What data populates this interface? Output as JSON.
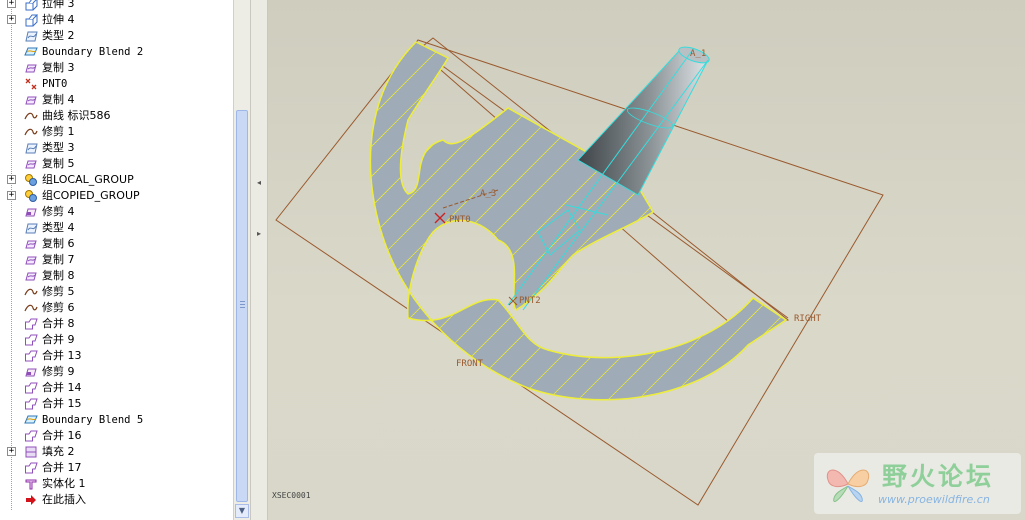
{
  "model_tree": {
    "items": [
      {
        "label": "拉伸 3",
        "icon": "extrude-icon",
        "expandable": true
      },
      {
        "label": "拉伸 4",
        "icon": "extrude-icon",
        "expandable": true
      },
      {
        "label": "类型 2",
        "icon": "style-curve-icon",
        "expandable": false
      },
      {
        "label": "Boundary Blend 2",
        "icon": "boundary-blend-icon",
        "expandable": false
      },
      {
        "label": "复制 3",
        "icon": "copy-surface-icon",
        "expandable": false
      },
      {
        "label": "PNT0",
        "icon": "datum-point-icon",
        "expandable": false
      },
      {
        "label": "复制 4",
        "icon": "copy-surface-icon",
        "expandable": false
      },
      {
        "label": "曲线 标识586",
        "icon": "datum-curve-icon",
        "expandable": false
      },
      {
        "label": "修剪 1",
        "icon": "datum-curve-icon",
        "expandable": false
      },
      {
        "label": "类型 3",
        "icon": "style-curve-icon",
        "expandable": false
      },
      {
        "label": "复制 5",
        "icon": "copy-surface-icon",
        "expandable": false
      },
      {
        "label": "组LOCAL_GROUP",
        "icon": "group-icon",
        "expandable": true
      },
      {
        "label": "组COPIED_GROUP",
        "icon": "group-icon",
        "expandable": true
      },
      {
        "label": "修剪 4",
        "icon": "trim-surface-icon",
        "expandable": false
      },
      {
        "label": "类型 4",
        "icon": "style-curve-icon",
        "expandable": false
      },
      {
        "label": "复制 6",
        "icon": "copy-surface-icon",
        "expandable": false
      },
      {
        "label": "复制 7",
        "icon": "copy-surface-icon",
        "expandable": false
      },
      {
        "label": "复制 8",
        "icon": "copy-surface-icon",
        "expandable": false
      },
      {
        "label": "修剪 5",
        "icon": "datum-curve-icon",
        "expandable": false
      },
      {
        "label": "修剪 6",
        "icon": "datum-curve-icon",
        "expandable": false
      },
      {
        "label": "合并 8",
        "icon": "merge-icon",
        "expandable": false
      },
      {
        "label": "合并 9",
        "icon": "merge-icon",
        "expandable": false
      },
      {
        "label": "合并 13",
        "icon": "merge-icon",
        "expandable": false
      },
      {
        "label": "修剪 9",
        "icon": "trim-surface-icon",
        "expandable": false
      },
      {
        "label": "合并 14",
        "icon": "merge-icon",
        "expandable": false
      },
      {
        "label": "合并 15",
        "icon": "merge-icon",
        "expandable": false
      },
      {
        "label": "Boundary Blend 5",
        "icon": "boundary-blend-icon",
        "expandable": false
      },
      {
        "label": "合并 16",
        "icon": "merge-icon",
        "expandable": false
      },
      {
        "label": "填充 2",
        "icon": "fill-icon",
        "expandable": true
      },
      {
        "label": "合并 17",
        "icon": "merge-icon",
        "expandable": false
      },
      {
        "label": "实体化 1",
        "icon": "solidify-icon",
        "expandable": false
      },
      {
        "label": "在此插入",
        "icon": "insert-here-arrow-icon",
        "expandable": false
      }
    ]
  },
  "viewport": {
    "datum_labels": {
      "axis_a1": "A_1",
      "axis_a3": "A_3",
      "pnt0": "PNT0",
      "pnt2": "PNT2",
      "front": "FRONT",
      "right": "RIGHT"
    },
    "status_text": "XSEC0001",
    "colors": {
      "surface_fill": "#9fabb6",
      "edge_yellow": "#eeee3a",
      "datum_brown": "#9a5a2e",
      "axis_cyan": "#36dcdc",
      "point_red": "#cc2222"
    }
  },
  "watermark": {
    "title": "野火论坛",
    "url": "www.proewildfire.cn"
  }
}
